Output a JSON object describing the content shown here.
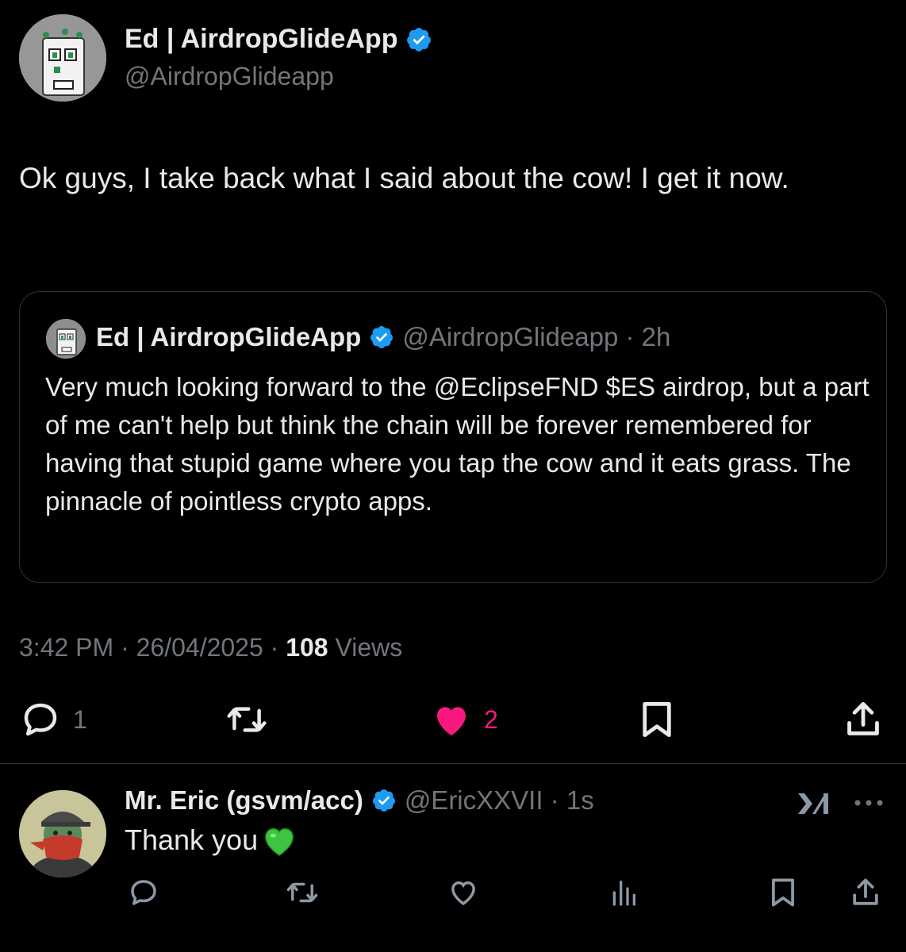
{
  "post": {
    "author_name": "Ed | AirdropGlideApp",
    "author_handle": "@AirdropGlideapp",
    "text": "Ok guys, I take back what I said about the cow! I get it now.",
    "time": "3:42 PM",
    "date": "26/04/2025",
    "views_count": "108",
    "views_label": "Views",
    "reply_count": "1",
    "like_count": "2",
    "colors": {
      "like": "#f91880",
      "verified": "#1d9bf0",
      "muted": "#71767b"
    }
  },
  "quote": {
    "author_name": "Ed | AirdropGlideApp",
    "author_handle": "@AirdropGlideapp",
    "age": "2h",
    "text": "Very much looking forward to the @EclipseFND $ES airdrop, but a part of me can't help but think the chain will be forever remembered for having that stupid game where you tap the cow and it eats grass. The pinnacle of pointless crypto apps."
  },
  "reply": {
    "author_name": "Mr. Eric (gsvm/acc)",
    "author_handle": "@EricXXVII",
    "age": "1s",
    "text": "Thank you",
    "emoji": "💚"
  },
  "separator": "·",
  "icons": [
    "verified-badge-icon",
    "reply-icon",
    "retweet-icon",
    "heart-icon",
    "bookmark-icon",
    "share-icon",
    "views-icon",
    "grok-icon",
    "more-icon"
  ]
}
